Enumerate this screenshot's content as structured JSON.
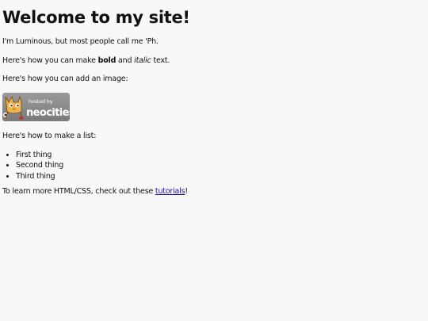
{
  "page": {
    "title": "Welcome to my site!",
    "intro": "I'm Luminous, but most people call me 'Ph.",
    "formatting": {
      "prefix": "Here's how you can make ",
      "bold": "bold",
      "middle": " and ",
      "italic": "italic",
      "suffix": " text."
    },
    "image_intro": "Here's how you can add an image:",
    "image": {
      "alt": "Hosted by Neocities",
      "line1": "hosted by",
      "line2": "neocities"
    },
    "list_intro": "Here's how to make a list:",
    "list_items": [
      "First thing",
      "Second thing",
      "Third thing"
    ],
    "learn_more": {
      "prefix": "To learn more HTML/CSS, check out these ",
      "link": "tutorials",
      "suffix": "!"
    }
  },
  "colors": {
    "background": "#f8f8f8",
    "text": "#111111",
    "link": "#1a0dab",
    "badge_bg": "#8a8a8a"
  }
}
